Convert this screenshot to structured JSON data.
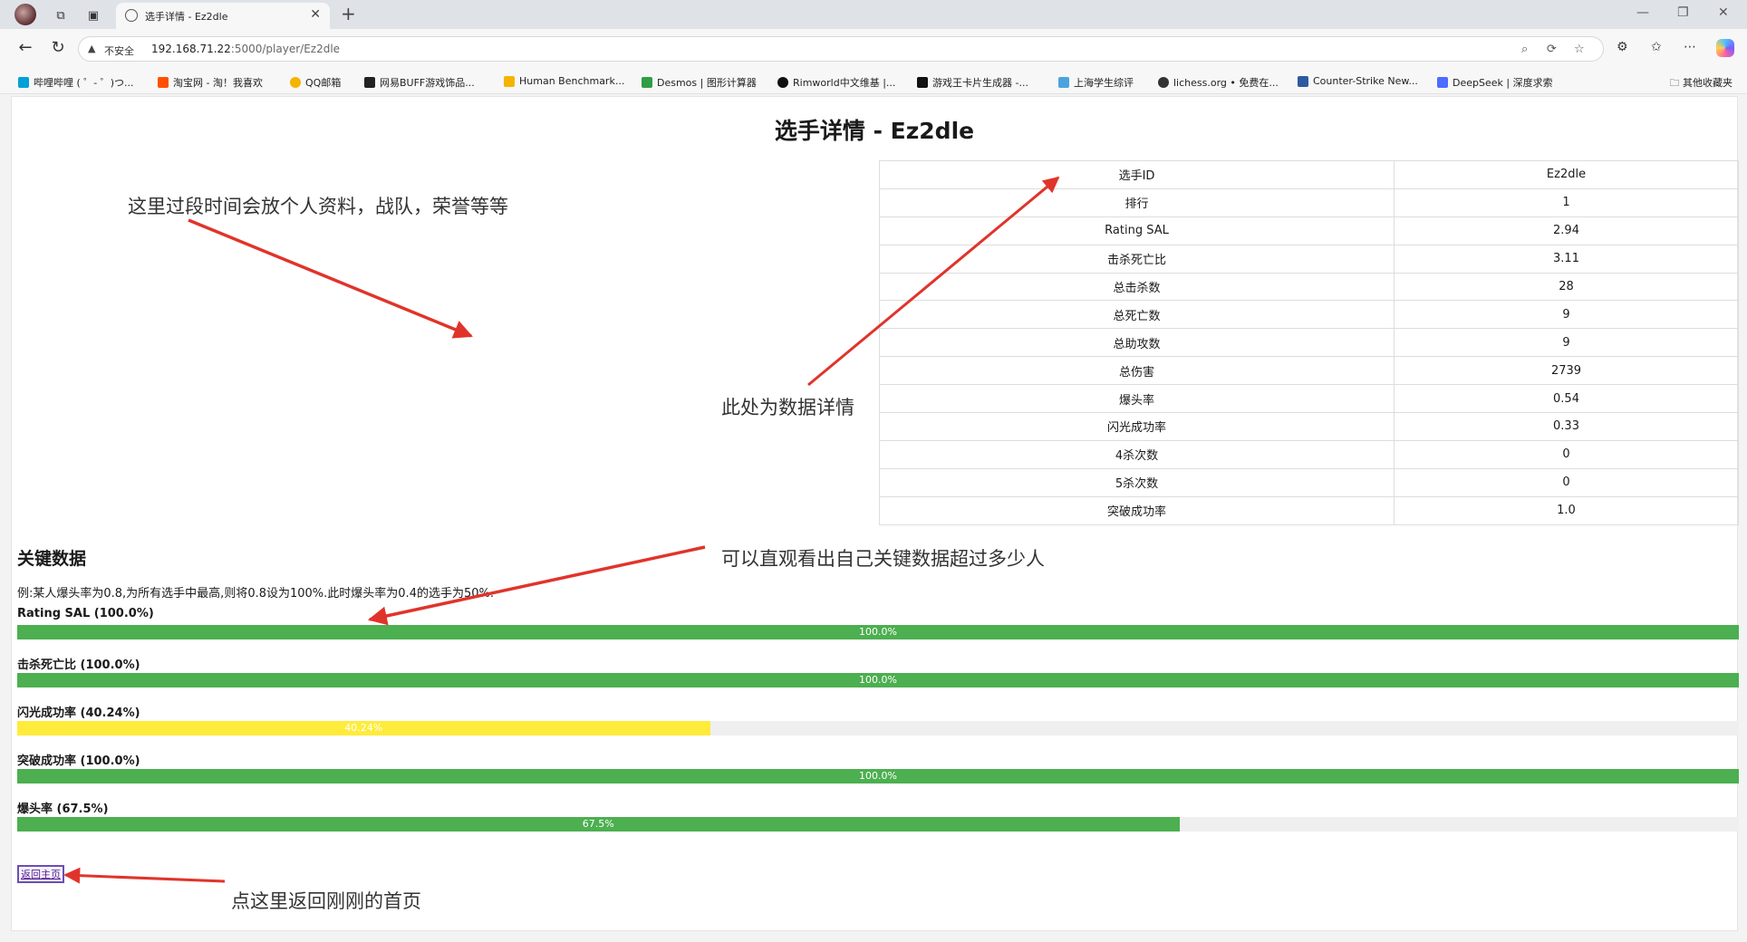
{
  "browser": {
    "tab_title": "选手详情 - Ez2dle",
    "security_label": "不安全",
    "url_host": "192.168.71.22",
    "url_path": ":5000/player/Ez2dle",
    "bookmarks": [
      {
        "label": "哔哩哔哩 ( ゜- ゜)つ...",
        "color": "#00a1d6"
      },
      {
        "label": "淘宝网 - 淘！我喜欢",
        "color": "#ff5000"
      },
      {
        "label": "QQ邮箱",
        "color": "#f5b400"
      },
      {
        "label": "网易BUFF游戏饰品...",
        "color": "#222222"
      },
      {
        "label": "Human Benchmark...",
        "color": "#f4b400"
      },
      {
        "label": "Desmos | 图形计算器",
        "color": "#2f9e44"
      },
      {
        "label": "Rimworld中文维基 |...",
        "color": "#111111"
      },
      {
        "label": "游戏王卡片生成器 -...",
        "color": "#111111"
      },
      {
        "label": "上海学生综评",
        "color": "#4aa3df"
      },
      {
        "label": "lichess.org • 免费在...",
        "color": "#333333"
      },
      {
        "label": "Counter-Strike New...",
        "color": "#2d5aa0"
      },
      {
        "label": "DeepSeek | 深度求索",
        "color": "#4d6bfe"
      }
    ],
    "other_bookmarks": "其他收藏夹"
  },
  "page": {
    "title": "选手详情 - Ez2dle",
    "stats": [
      {
        "label": "选手ID",
        "value": "Ez2dle"
      },
      {
        "label": "排行",
        "value": "1"
      },
      {
        "label": "Rating SAL",
        "value": "2.94"
      },
      {
        "label": "击杀死亡比",
        "value": "3.11"
      },
      {
        "label": "总击杀数",
        "value": "28"
      },
      {
        "label": "总死亡数",
        "value": "9"
      },
      {
        "label": "总助攻数",
        "value": "9"
      },
      {
        "label": "总伤害",
        "value": "2739"
      },
      {
        "label": "爆头率",
        "value": "0.54"
      },
      {
        "label": "闪光成功率",
        "value": "0.33"
      },
      {
        "label": "4杀次数",
        "value": "0"
      },
      {
        "label": "5杀次数",
        "value": "0"
      },
      {
        "label": "突破成功率",
        "value": "1.0"
      }
    ],
    "key_heading": "关键数据",
    "key_description": "例:某人爆头率为0.8,为所有选手中最高,则将0.8设为100%.此时爆头率为0.4的选手为50%.",
    "metrics": [
      {
        "label": "Rating SAL (100.0%)",
        "percent": 100.0,
        "bar_text": "100.0%",
        "color": "#4caf50"
      },
      {
        "label": "击杀死亡比 (100.0%)",
        "percent": 100.0,
        "bar_text": "100.0%",
        "color": "#4caf50"
      },
      {
        "label": "闪光成功率 (40.24%)",
        "percent": 40.24,
        "bar_text": "40.24%",
        "color": "#ffeb3b"
      },
      {
        "label": "突破成功率 (100.0%)",
        "percent": 100.0,
        "bar_text": "100.0%",
        "color": "#4caf50"
      },
      {
        "label": "爆头率 (67.5%)",
        "percent": 67.5,
        "bar_text": "67.5%",
        "color": "#4caf50"
      }
    ],
    "back_link": "返回主页"
  },
  "annotations": {
    "profile_note": "这里过段时间会放个人资料，战队，荣誉等等",
    "stats_note": "此处为数据详情",
    "key_note": "可以直观看出自己关键数据超过多少人",
    "back_note": "点这里返回刚刚的首页",
    "arrow_color": "#e0342b"
  }
}
